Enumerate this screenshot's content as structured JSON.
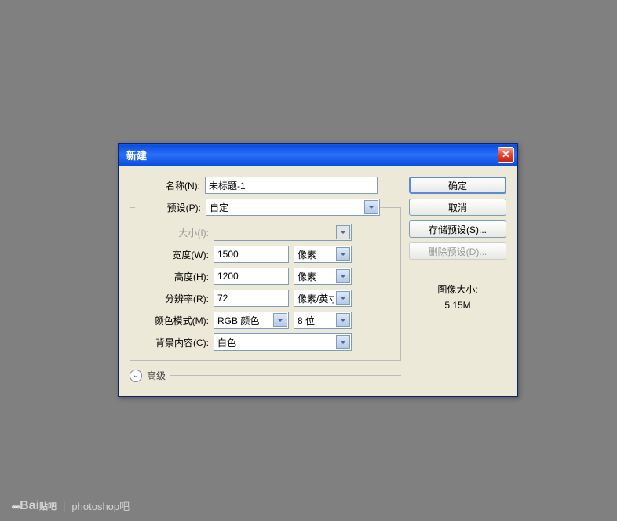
{
  "dialog": {
    "title": "新建",
    "name_label": "名称(N):",
    "name_value": "未标题-1",
    "preset_label": "预设(P):",
    "preset_value": "自定",
    "size_label": "大小(I):",
    "size_value": "",
    "width_label": "宽度(W):",
    "width_value": "1500",
    "width_unit": "像素",
    "height_label": "高度(H):",
    "height_value": "1200",
    "height_unit": "像素",
    "resolution_label": "分辨率(R):",
    "resolution_value": "72",
    "resolution_unit": "像素/英寸",
    "colormode_label": "颜色模式(M):",
    "colormode_value": "RGB 颜色",
    "bitdepth_value": "8 位",
    "background_label": "背景内容(C):",
    "background_value": "白色",
    "advanced_label": "高级"
  },
  "buttons": {
    "ok": "确定",
    "cancel": "取消",
    "save_preset": "存储预设(S)...",
    "delete_preset": "删除预设(D)..."
  },
  "info": {
    "imagesize_label": "图像大小:",
    "imagesize_value": "5.15M"
  },
  "watermark": {
    "brand": "Bai",
    "brand2": "贴吧",
    "forum": "photoshop吧"
  }
}
